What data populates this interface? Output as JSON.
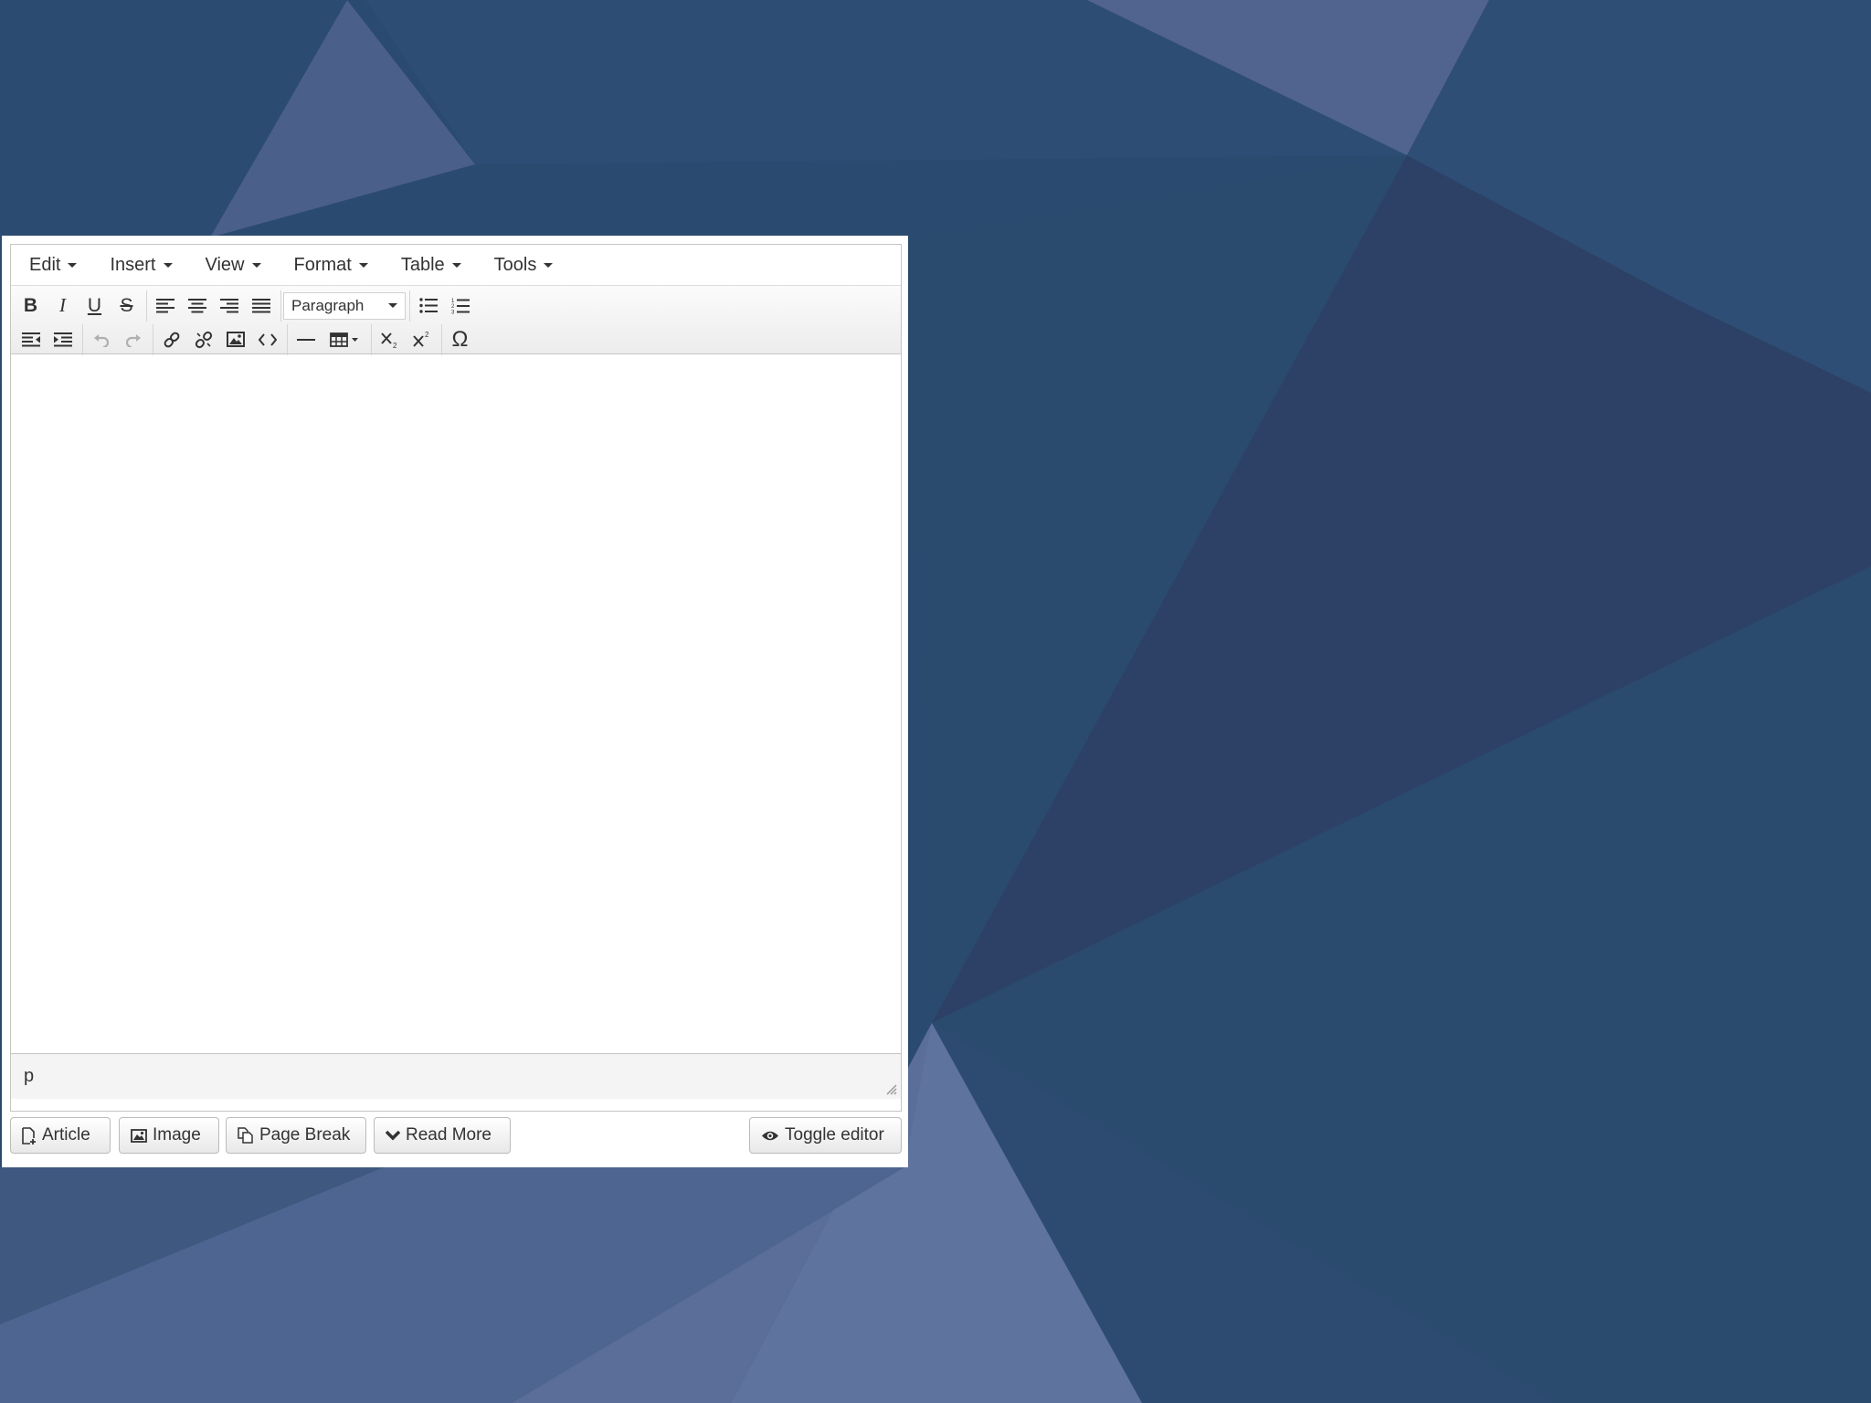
{
  "colors": {
    "background": "#2a4a6e",
    "editor_panel": "#ffffff",
    "toolbar_gradient_top": "#fbfbfb",
    "toolbar_gradient_bottom": "#ececec"
  },
  "menubar": {
    "items": [
      {
        "label": "Edit"
      },
      {
        "label": "Insert"
      },
      {
        "label": "View"
      },
      {
        "label": "Format"
      },
      {
        "label": "Table"
      },
      {
        "label": "Tools"
      }
    ]
  },
  "toolbar": {
    "row1": {
      "bold": "B",
      "italic": "I",
      "underline": "U",
      "strike": "S",
      "align_icons": [
        "align-left-icon",
        "align-center-icon",
        "align-right-icon",
        "align-justify-icon"
      ],
      "format_select": "Paragraph",
      "list_icons": [
        "bullet-list-icon",
        "numbered-list-icon"
      ]
    },
    "row2": {
      "icons": [
        "outdent-icon",
        "indent-icon",
        "undo-icon",
        "redo-icon",
        "link-icon",
        "unlink-icon",
        "image-icon",
        "code-icon",
        "horizontal-rule-icon",
        "table-icon",
        "subscript-icon",
        "superscript-icon",
        "special-character-icon"
      ],
      "special_char": "Ω"
    }
  },
  "statusbar": {
    "path": "p"
  },
  "buttons": {
    "article": "Article",
    "image": "Image",
    "page_break": "Page Break",
    "read_more": "Read More",
    "toggle_editor": "Toggle editor"
  }
}
